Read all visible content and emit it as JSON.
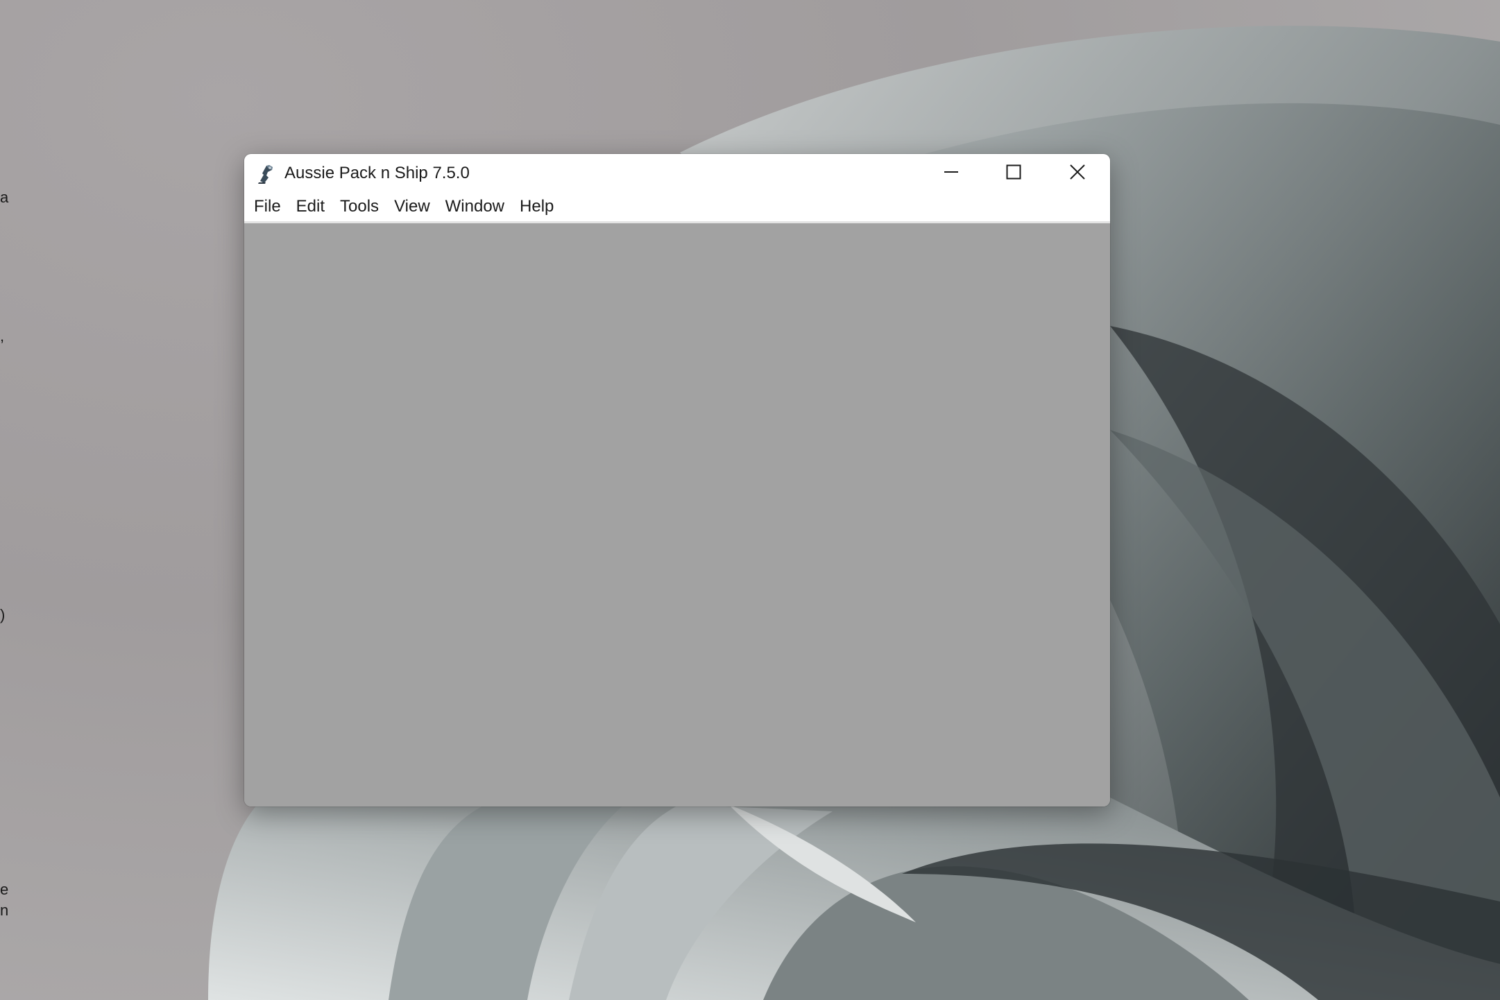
{
  "window": {
    "title": "Aussie Pack n Ship 7.5.0",
    "app_icon": "rubber-stamp-icon",
    "controls": {
      "minimize_icon": "minimize-icon",
      "maximize_icon": "maximize-icon",
      "close_icon": "close-icon"
    }
  },
  "menu": {
    "items": [
      {
        "label": "File"
      },
      {
        "label": "Edit"
      },
      {
        "label": "Tools"
      },
      {
        "label": "View"
      },
      {
        "label": "Window"
      },
      {
        "label": "Help"
      }
    ]
  },
  "desktop": {
    "fragments": [
      {
        "text": "a"
      },
      {
        "text": ","
      },
      {
        "text": ")"
      },
      {
        "text": "e"
      },
      {
        "text": "n"
      }
    ]
  },
  "colors": {
    "client_background": "#a2a2a2",
    "titlebar_background": "#ffffff",
    "text": "#1a1a1a"
  }
}
